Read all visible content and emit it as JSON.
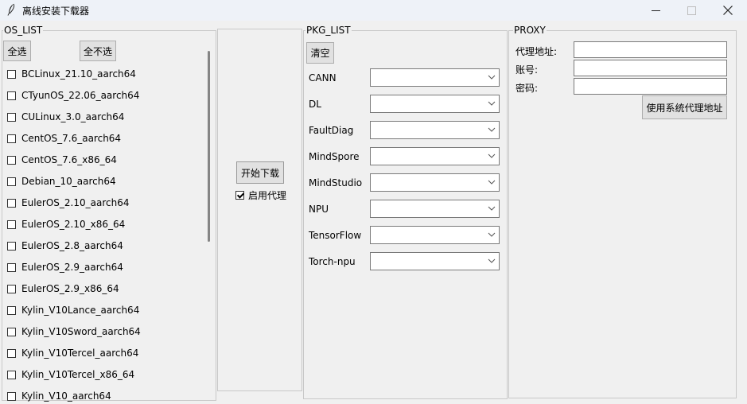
{
  "window": {
    "title": "离线安装下载器",
    "icon": "feather-icon",
    "controls": [
      "minimize-icon",
      "maximize-icon",
      "close-icon"
    ]
  },
  "os_list": {
    "legend": "OS_LIST",
    "select_all_label": "全选",
    "deselect_all_label": "全不选",
    "items": [
      {
        "label": "BCLinux_21.10_aarch64",
        "checked": false
      },
      {
        "label": "CTyunOS_22.06_aarch64",
        "checked": false
      },
      {
        "label": "CULinux_3.0_aarch64",
        "checked": false
      },
      {
        "label": "CentOS_7.6_aarch64",
        "checked": false
      },
      {
        "label": "CentOS_7.6_x86_64",
        "checked": false
      },
      {
        "label": "Debian_10_aarch64",
        "checked": false
      },
      {
        "label": "EulerOS_2.10_aarch64",
        "checked": false
      },
      {
        "label": "EulerOS_2.10_x86_64",
        "checked": false
      },
      {
        "label": "EulerOS_2.8_aarch64",
        "checked": false
      },
      {
        "label": "EulerOS_2.9_aarch64",
        "checked": false
      },
      {
        "label": "EulerOS_2.9_x86_64",
        "checked": false
      },
      {
        "label": "Kylin_V10Lance_aarch64",
        "checked": false
      },
      {
        "label": "Kylin_V10Sword_aarch64",
        "checked": false
      },
      {
        "label": "Kylin_V10Tercel_aarch64",
        "checked": false
      },
      {
        "label": "Kylin_V10Tercel_x86_64",
        "checked": false
      },
      {
        "label": "Kylin_V10_aarch64",
        "checked": false
      }
    ]
  },
  "actions": {
    "download_label": "开始下载",
    "use_proxy_label": "启用代理",
    "use_proxy_checked": true
  },
  "pkg_list": {
    "legend": "PKG_LIST",
    "clear_label": "清空",
    "packages": [
      {
        "label": "CANN",
        "value": ""
      },
      {
        "label": "DL",
        "value": ""
      },
      {
        "label": "FaultDiag",
        "value": ""
      },
      {
        "label": "MindSpore",
        "value": ""
      },
      {
        "label": "MindStudio",
        "value": ""
      },
      {
        "label": "NPU",
        "value": ""
      },
      {
        "label": "TensorFlow",
        "value": ""
      },
      {
        "label": "Torch-npu",
        "value": ""
      }
    ]
  },
  "proxy": {
    "legend": "PROXY",
    "address_label": "代理地址:",
    "address_value": "",
    "account_label": "账号:",
    "account_value": "",
    "password_label": "密码:",
    "password_value": "",
    "use_system_label": "使用系统代理地址"
  }
}
